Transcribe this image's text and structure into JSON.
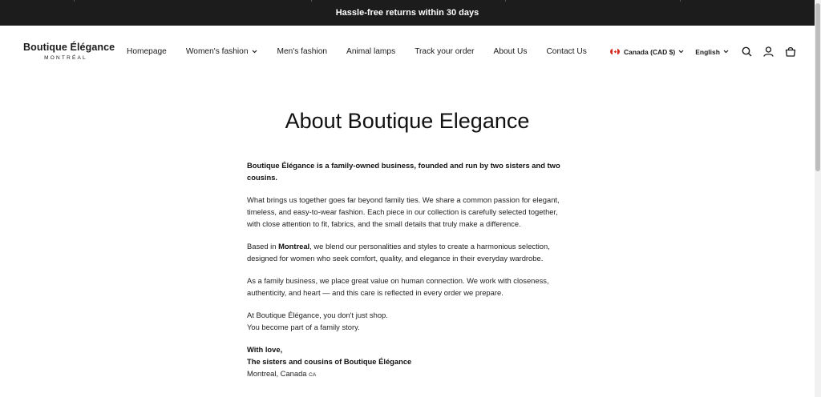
{
  "announcement": "Hassle-free returns within 30 days",
  "logo": {
    "name": "Boutique Élégance",
    "city": "MONTRÉAL"
  },
  "nav": {
    "items": [
      {
        "label": "Homepage"
      },
      {
        "label": "Women's fashion",
        "has_dropdown": true
      },
      {
        "label": "Men's fashion"
      },
      {
        "label": "Animal lamps"
      },
      {
        "label": "Track your order"
      },
      {
        "label": "About Us"
      },
      {
        "label": "Contact Us"
      }
    ]
  },
  "header_right": {
    "country": "Canada (CAD $)",
    "language": "English",
    "icons": [
      "search-icon",
      "account-icon",
      "cart-icon"
    ]
  },
  "page": {
    "title": "About Boutique Elegance",
    "intro": "Boutique Élégance is a family-owned business, founded and run by two sisters and two cousins.",
    "p1": "What brings us together goes far beyond family ties. We share a common passion for elegant, timeless, and easy-to-wear fashion. Each piece in our collection is carefully selected together, with close attention to fit, fabrics, and the small details that truly make a difference.",
    "p2_before": "Based in ",
    "p2_bold": "Montreal",
    "p2_after": ", we blend our personalities and styles to create a harmonious selection, designed for women who seek comfort, quality, and elegance in their everyday wardrobe.",
    "p3": "As a family business, we place great value on human connection. We work with closeness, authenticity, and heart — and this care is reflected in every order we prepare.",
    "p4_line1": "At Boutique Élégance, you don't just shop.",
    "p4_line2": "You become part of a family story.",
    "sign_1": "With love,",
    "sign_2": "The sisters and cousins of Boutique Élégance",
    "location": "Montreal, Canada",
    "location_code": "CA"
  },
  "colors": {
    "announcement_bg": "#1c1c1c",
    "text": "#1a1a1a",
    "flag_red": "#d52b1e"
  }
}
